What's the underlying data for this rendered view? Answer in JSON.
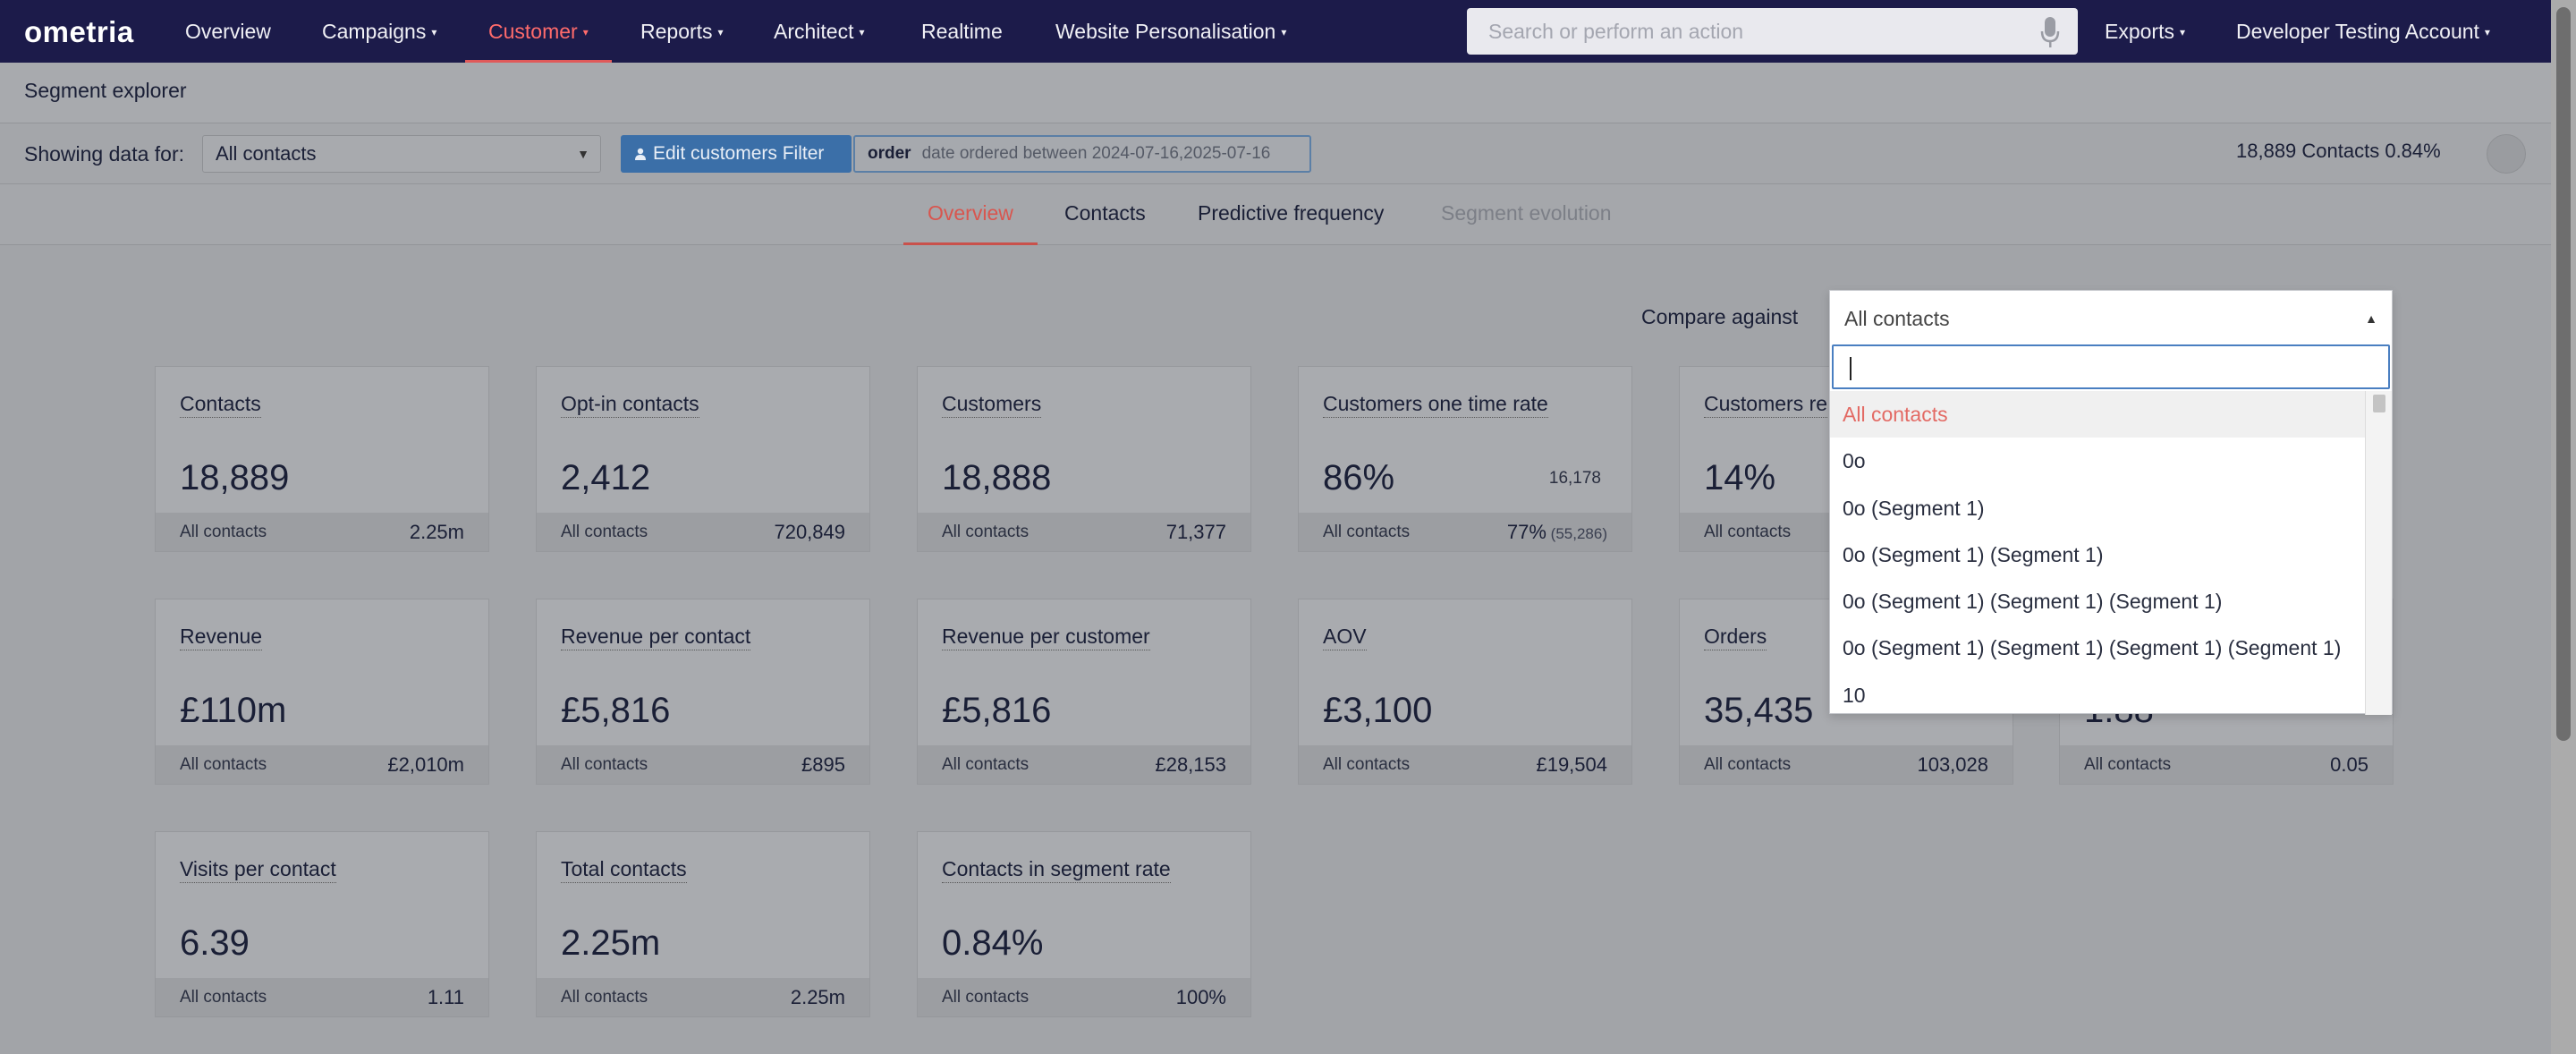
{
  "brand": {
    "logo": "ometria"
  },
  "nav": {
    "items": [
      {
        "label": "Overview",
        "caret": false,
        "active": false
      },
      {
        "label": "Campaigns",
        "caret": true,
        "active": false
      },
      {
        "label": "Customer",
        "caret": true,
        "active": true
      },
      {
        "label": "Reports",
        "caret": true,
        "active": false
      },
      {
        "label": "Architect",
        "caret": true,
        "active": false
      },
      {
        "label": "Realtime",
        "caret": false,
        "active": false
      },
      {
        "label": "Website Personalisation",
        "caret": true,
        "active": false
      }
    ],
    "search_placeholder": "Search or perform an action",
    "exports": "Exports",
    "account": "Developer Testing Account",
    "caret": "▾"
  },
  "page": {
    "title": "Segment explorer"
  },
  "filter": {
    "showing_label": "Showing data for:",
    "selected": "All contacts",
    "edit_button": "Edit customers Filter",
    "chip_type": "order",
    "chip_text": "date ordered  between  2024-07-16,2025-07-16",
    "summary": "18,889 Contacts   0.84%"
  },
  "tabs": [
    {
      "label": "Overview",
      "state": "active"
    },
    {
      "label": "Contacts",
      "state": "normal"
    },
    {
      "label": "Predictive frequency",
      "state": "normal"
    },
    {
      "label": "Segment evolution",
      "state": "disabled"
    }
  ],
  "compare": {
    "label": "Compare against",
    "selected": "All contacts",
    "options": [
      "All contacts",
      "0o",
      "0o (Segment 1)",
      "0o (Segment 1) (Segment 1)",
      "0o (Segment 1) (Segment 1) (Segment 1)",
      "0o (Segment 1) (Segment 1) (Segment 1) (Segment 1)",
      "10"
    ]
  },
  "cards": [
    {
      "title": "Contacts",
      "value": "18,889",
      "side": "",
      "foot_label": "All contacts",
      "foot_value": "2.25m",
      "foot_note": ""
    },
    {
      "title": "Opt-in contacts",
      "value": "2,412",
      "side": "",
      "foot_label": "All contacts",
      "foot_value": "720,849",
      "foot_note": ""
    },
    {
      "title": "Customers",
      "value": "18,888",
      "side": "",
      "foot_label": "All contacts",
      "foot_value": "71,377",
      "foot_note": ""
    },
    {
      "title": "Customers one time rate",
      "value": "86%",
      "side": "16,178",
      "foot_label": "All contacts",
      "foot_value": "77%",
      "foot_note": " (55,286)"
    },
    {
      "title": "Customers re",
      "value": "14%",
      "side": "",
      "foot_label": "All contacts",
      "foot_value": "",
      "foot_note": ""
    },
    {
      "title": "Revenue",
      "value": "£110m",
      "side": "",
      "foot_label": "All contacts",
      "foot_value": "£2,010m",
      "foot_note": ""
    },
    {
      "title": "Revenue per contact",
      "value": "£5,816",
      "side": "",
      "foot_label": "All contacts",
      "foot_value": "£895",
      "foot_note": ""
    },
    {
      "title": "Revenue per customer",
      "value": "£5,816",
      "side": "",
      "foot_label": "All contacts",
      "foot_value": "£28,153",
      "foot_note": ""
    },
    {
      "title": "AOV",
      "value": "£3,100",
      "side": "",
      "foot_label": "All contacts",
      "foot_value": "£19,504",
      "foot_note": ""
    },
    {
      "title": "Orders",
      "value": "35,435",
      "side": "",
      "foot_label": "All contacts",
      "foot_value": "103,028",
      "foot_note": ""
    },
    {
      "title": "",
      "value": "1.88",
      "side": "",
      "foot_label": "All contacts",
      "foot_value": "0.05",
      "foot_note": ""
    },
    {
      "title": "Visits per contact",
      "value": "6.39",
      "side": "",
      "foot_label": "All contacts",
      "foot_value": "1.11",
      "foot_note": ""
    },
    {
      "title": "Total contacts",
      "value": "2.25m",
      "side": "",
      "foot_label": "All contacts",
      "foot_value": "2.25m",
      "foot_note": ""
    },
    {
      "title": "Contacts in segment rate",
      "value": "0.84%",
      "side": "",
      "foot_label": "All contacts",
      "foot_value": "100%",
      "foot_note": ""
    }
  ]
}
